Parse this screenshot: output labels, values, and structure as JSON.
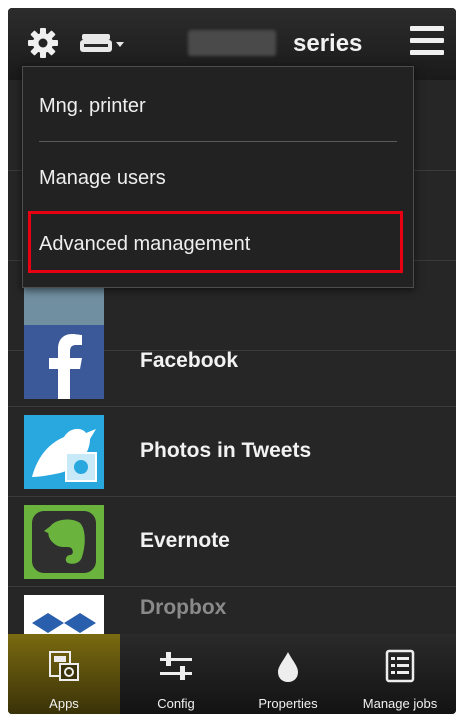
{
  "header": {
    "series_label": "series",
    "icons": [
      "settings-gear-icon",
      "printer-icon",
      "chevron-down-icon",
      "menu-icon"
    ]
  },
  "menu": {
    "items": [
      {
        "label": "Mng. printer"
      },
      {
        "label": "Manage users"
      },
      {
        "label": "Advanced management"
      }
    ],
    "highlighted_item": "Advanced management",
    "highlight_color": "#e60012"
  },
  "apps": {
    "items": [
      {
        "label": "Facebook",
        "icon": "facebook-icon",
        "color": "#3b5998"
      },
      {
        "label": "Photos in Tweets",
        "icon": "photos-in-tweets-icon",
        "color": "#1da1f2"
      },
      {
        "label": "Evernote",
        "icon": "evernote-icon",
        "color": "#5ba525"
      },
      {
        "label": "Dropbox",
        "icon": "dropbox-icon",
        "color": "#007ee5"
      }
    ]
  },
  "tabs": [
    {
      "label": "Apps",
      "icon": "apps-icon",
      "active": true
    },
    {
      "label": "Config",
      "icon": "config-sliders-icon",
      "active": false
    },
    {
      "label": "Properties",
      "icon": "ink-drop-icon",
      "active": false
    },
    {
      "label": "Manage jobs",
      "icon": "job-list-icon",
      "active": false
    }
  ]
}
